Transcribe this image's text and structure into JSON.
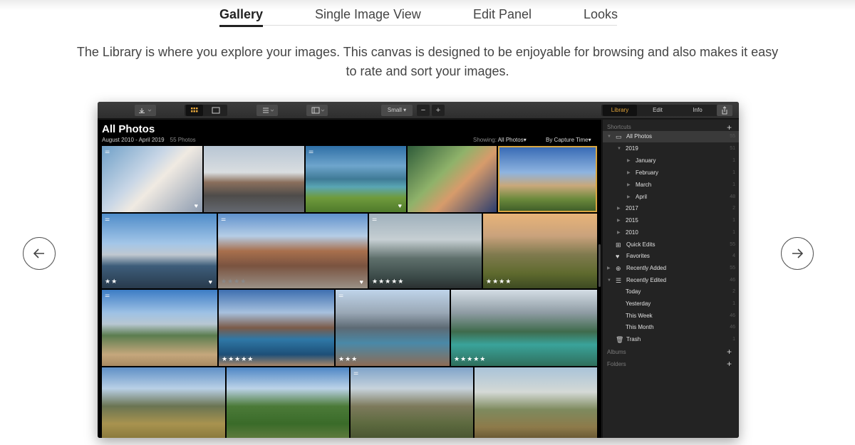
{
  "tabs": [
    {
      "label": "Gallery"
    },
    {
      "label": "Single Image View"
    },
    {
      "label": "Edit Panel"
    },
    {
      "label": "Looks"
    }
  ],
  "description": "The Library is where you explore your images. This canvas is designed to be enjoyable for browsing and also makes it easy to rate and sort your images.",
  "app": {
    "toolbar": {
      "size_label": "Small",
      "zoom_out": "−",
      "zoom_in": "+",
      "modes": [
        "Library",
        "Edit",
        "Info"
      ],
      "active_mode": "Library",
      "icons": [
        "import-icon",
        "grid-view-icon",
        "single-view-icon",
        "list-options-icon",
        "panel-layout-icon",
        "share-icon"
      ]
    },
    "main": {
      "title": "All Photos",
      "date_range": "August 2010 - April 2019",
      "count": "55 Photos",
      "showing_label": "Showing:",
      "showing_value": "All Photos",
      "sort_value": "By Capture Time",
      "photos": [
        {
          "rating": "",
          "favorite": true,
          "edited": true
        },
        {
          "rating": "",
          "favorite": false,
          "edited": false
        },
        {
          "rating": "",
          "favorite": true,
          "edited": true
        },
        {
          "rating": "",
          "favorite": false,
          "edited": false
        },
        {
          "rating": "",
          "favorite": false,
          "edited": false,
          "selected": true
        },
        {
          "rating": "★★",
          "favorite": true,
          "edited": true
        },
        {
          "rating": "★★★★",
          "favorite": true,
          "edited": true
        },
        {
          "rating": "★★★★★",
          "favorite": false,
          "edited": true
        },
        {
          "rating": "★★★★",
          "favorite": false,
          "edited": false
        },
        {
          "rating": "",
          "favorite": false,
          "edited": true
        },
        {
          "rating": "★★★★★",
          "favorite": false,
          "edited": false
        },
        {
          "rating": "★★★",
          "favorite": false,
          "edited": true
        },
        {
          "rating": "★★★★★",
          "favorite": false,
          "edited": false
        },
        {
          "rating": "",
          "favorite": false,
          "edited": false
        },
        {
          "rating": "",
          "favorite": false,
          "edited": false
        },
        {
          "rating": "",
          "favorite": false,
          "edited": true
        },
        {
          "rating": "",
          "favorite": false,
          "edited": false
        }
      ]
    },
    "sidebar": {
      "shortcuts_label": "Shortcuts",
      "rows": [
        {
          "label": "All Photos",
          "count": "55"
        },
        {
          "label": "2019",
          "count": "51"
        },
        {
          "label": "January",
          "count": "1"
        },
        {
          "label": "February",
          "count": "1"
        },
        {
          "label": "March",
          "count": "1"
        },
        {
          "label": "April",
          "count": "48"
        },
        {
          "label": "2017",
          "count": "2"
        },
        {
          "label": "2015",
          "count": "1"
        },
        {
          "label": "2010",
          "count": "1"
        },
        {
          "label": "Quick Edits",
          "count": "55"
        },
        {
          "label": "Favorites",
          "count": "4"
        },
        {
          "label": "Recently Added",
          "count": "55"
        },
        {
          "label": "Recently Edited",
          "count": "46"
        },
        {
          "label": "Today",
          "count": "2"
        },
        {
          "label": "Yesterday",
          "count": "1"
        },
        {
          "label": "This Week",
          "count": "46"
        },
        {
          "label": "This Month",
          "count": "46"
        },
        {
          "label": "Trash",
          "count": "1"
        }
      ],
      "albums_label": "Albums",
      "folders_label": "Folders"
    }
  },
  "nav": {
    "prev_icon": "arrow-left-icon",
    "next_icon": "arrow-right-icon"
  },
  "colors": {
    "accent": "#e3a53b",
    "app_bg": "#1b1b1b",
    "sidebar_bg": "#232323"
  }
}
